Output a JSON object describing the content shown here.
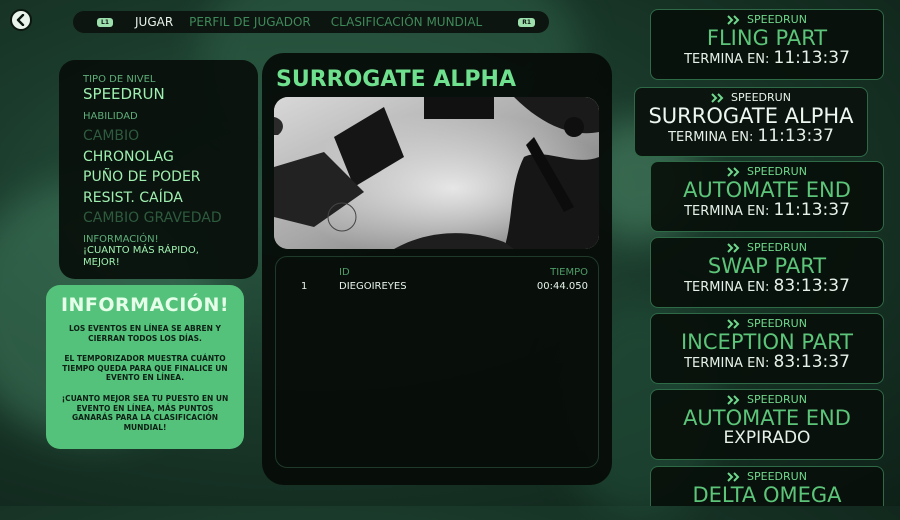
{
  "nav": {
    "hint_left": "L1",
    "hint_right": "R1",
    "tabs": [
      {
        "label": "JUGAR",
        "active": true
      },
      {
        "label": "PERFIL DE JUGADOR",
        "active": false
      },
      {
        "label": "CLASIFICACIÓN MUNDIAL",
        "active": false
      }
    ]
  },
  "level_info": {
    "type_label": "TIPO DE NIVEL",
    "type_value": "SPEEDRUN",
    "ability_label": "HABILIDAD",
    "abilities": [
      {
        "name": "CAMBIO",
        "enabled": false
      },
      {
        "name": "CHRONOLAG",
        "enabled": true
      },
      {
        "name": "PUÑO DE PODER",
        "enabled": true
      },
      {
        "name": "RESIST. CAÍDA",
        "enabled": true
      },
      {
        "name": "CAMBIO GRAVEDAD",
        "enabled": false
      }
    ],
    "info_label": "INFORMACIÓN!",
    "info_line1": "¡CUANTO MÁS RÁPIDO,",
    "info_line2": "MEJOR!"
  },
  "info_card": {
    "title": "INFORMACIÓN!",
    "p1": "LOS EVENTOS EN LÍNEA SE ABREN Y CIERRAN TODOS LOS DÍAS.",
    "p2": "EL TEMPORIZADOR MUESTRA CUÁNTO TIEMPO QUEDA PARA QUE FINALICE UN EVENTO EN LÍNEA.",
    "p3": "¡CUANTO MEJOR SEA TU PUESTO EN UN EVENTO EN LÍNEA, MÁS PUNTOS GANARÁS PARA LA CLASIFICACIÓN MUNDIAL!"
  },
  "selected_level": {
    "title": "SURROGATE ALPHA"
  },
  "leaderboard": {
    "headers": {
      "id": "ID",
      "time": "TIEMPO"
    },
    "rows": [
      {
        "rank": "1",
        "id": "DIEGOIREYES",
        "time": "00:44.050"
      }
    ]
  },
  "events": [
    {
      "type": "SPEEDRUN",
      "name": "FLING PART",
      "time_label": "TERMINA EN:",
      "time": "11:13:37",
      "expired": false,
      "selected": false
    },
    {
      "type": "SPEEDRUN",
      "name": "SURROGATE ALPHA",
      "time_label": "TERMINA EN:",
      "time": "11:13:37",
      "expired": false,
      "selected": true
    },
    {
      "type": "SPEEDRUN",
      "name": "AUTOMATE END",
      "time_label": "TERMINA EN:",
      "time": "11:13:37",
      "expired": false,
      "selected": false
    },
    {
      "type": "SPEEDRUN",
      "name": "SWAP PART",
      "time_label": "TERMINA EN:",
      "time": "83:13:37",
      "expired": false,
      "selected": false
    },
    {
      "type": "SPEEDRUN",
      "name": "INCEPTION PART",
      "time_label": "TERMINA EN:",
      "time": "83:13:37",
      "expired": false,
      "selected": false
    },
    {
      "type": "SPEEDRUN",
      "name": "AUTOMATE END",
      "status": "EXPIRADO",
      "expired": true,
      "selected": false
    },
    {
      "type": "SPEEDRUN",
      "name": "DELTA OMEGA",
      "expired": false,
      "selected": false
    }
  ],
  "colors": {
    "accent": "#5cc579",
    "panel": "#0a120d",
    "card": "#54c27a"
  }
}
